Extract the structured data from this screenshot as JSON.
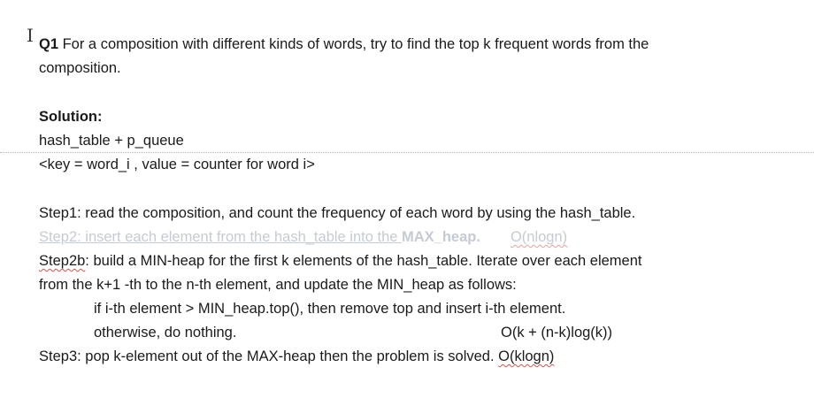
{
  "q1": {
    "label": "Q1",
    "text_line1": " For a composition with different kinds of words, try to find the top k frequent words from the",
    "text_line2": "composition."
  },
  "solution": {
    "heading": "Solution:",
    "line1": "hash_table + p_queue",
    "line2": "<key = word_i , value = counter for word i>"
  },
  "steps": {
    "step1": "Step1: read the composition, and count the frequency of each word by using the hash_table.",
    "step2_text": "Step2:  insert each element from the hash_table into the ",
    "step2_bold": "MAX_heap.",
    "step2_complexity": "O(nlogn)",
    "step2b_label": "Step2b",
    "step2b_text": ": build a MIN-heap for the first k elements of the hash_table.    Iterate over each element",
    "step2b_line2": "from the k+1 -th to the n-th element, and  update the MIN_heap as follows:",
    "cond_line1": "if i-th element  > MIN_heap.top(),  then remove top and insert i-th element.",
    "cond_line2": "otherwise, do nothing.",
    "cond_complexity": "O(k  + (n-k)log(k))",
    "step3_text": "Step3: pop k-element out of the MAX-heap then the problem is solved.   ",
    "step3_complexity": "O(klogn)"
  }
}
